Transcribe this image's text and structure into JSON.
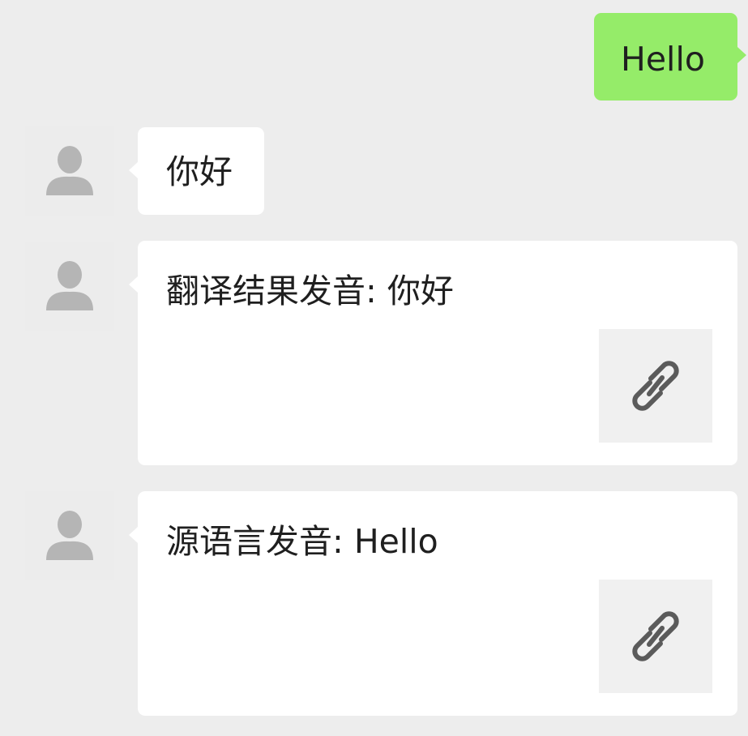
{
  "messages": [
    {
      "sender": "self",
      "text": "Hello"
    },
    {
      "sender": "other",
      "text": "你好"
    },
    {
      "sender": "other",
      "text": "翻译结果发音: 你好",
      "attachment": {
        "icon": "link-icon"
      }
    },
    {
      "sender": "other",
      "text": "源语言发音: Hello",
      "attachment": {
        "icon": "link-icon"
      }
    }
  ],
  "icons": {
    "avatar": "user-silhouette-icon",
    "attachment": "link-icon"
  },
  "colors": {
    "background": "#ededed",
    "self_bubble": "#95ec69",
    "other_bubble": "#ffffff",
    "avatar_bg": "#ececec",
    "avatar_icon": "#b5b5b5",
    "link_card_bg": "#f0f0f0",
    "link_icon": "#5b5b5b"
  }
}
